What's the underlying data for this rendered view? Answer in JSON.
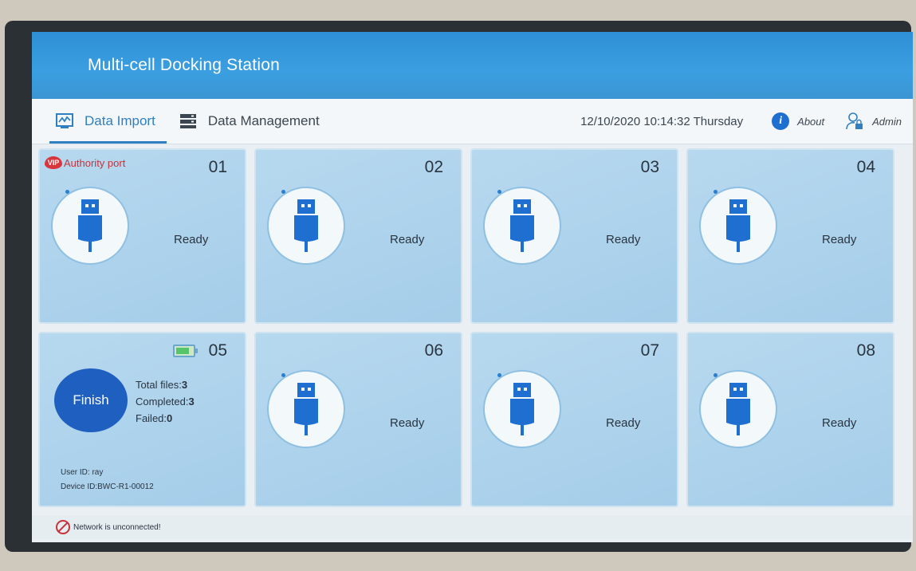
{
  "app": {
    "title": "Multi-cell Docking Station"
  },
  "nav": {
    "tabs": [
      {
        "label": "Data Import",
        "icon": "chart-monitor-icon",
        "active": true
      },
      {
        "label": "Data Management",
        "icon": "server-icon",
        "active": false
      }
    ],
    "datetime": "12/10/2020 10:14:32 Thursday",
    "about_label": "About",
    "admin_label": "Admin"
  },
  "ports": [
    {
      "number": "01",
      "status": "Ready",
      "badge": "VIP",
      "badge_label": "Authority port"
    },
    {
      "number": "02",
      "status": "Ready"
    },
    {
      "number": "03",
      "status": "Ready"
    },
    {
      "number": "04",
      "status": "Ready"
    },
    {
      "number": "05",
      "button": "Finish",
      "total_label": "Total files:",
      "total": "3",
      "completed_label": "Completed:",
      "completed": "3",
      "failed_label": "Failed:",
      "failed": "0",
      "user_id": "User ID:   ray",
      "device_id": "Device ID:BWC-R1-00012"
    },
    {
      "number": "06",
      "status": "Ready"
    },
    {
      "number": "07",
      "status": "Ready"
    },
    {
      "number": "08",
      "status": "Ready"
    }
  ],
  "status_bar": {
    "message": "Network is unconnected!"
  },
  "colors": {
    "accent": "#2f7fc1",
    "title_bar": "#3a9fe0",
    "tile": "#a5cde9",
    "finish": "#1f5fbf",
    "warning": "#c8323a"
  }
}
